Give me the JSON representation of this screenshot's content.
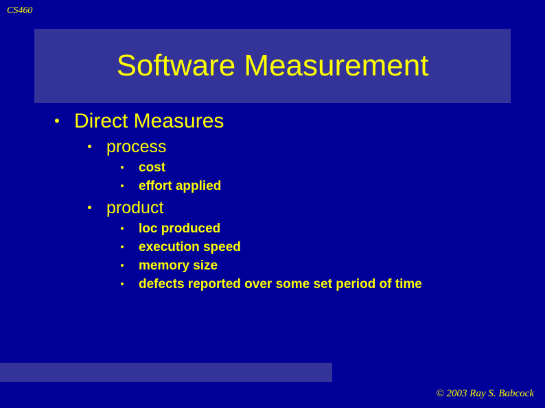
{
  "course": "CS460",
  "title": "Software Measurement",
  "heading": "Direct Measures",
  "sections": {
    "a": {
      "label": "process",
      "items": {
        "0": "cost",
        "1": "effort applied"
      }
    },
    "b": {
      "label": "product",
      "items": {
        "0": "loc produced",
        "1": "execution speed",
        "2": "memory size",
        "3": "defects reported over some set period of time"
      }
    }
  },
  "copyright": "© 2003  Ray S. Babcock"
}
